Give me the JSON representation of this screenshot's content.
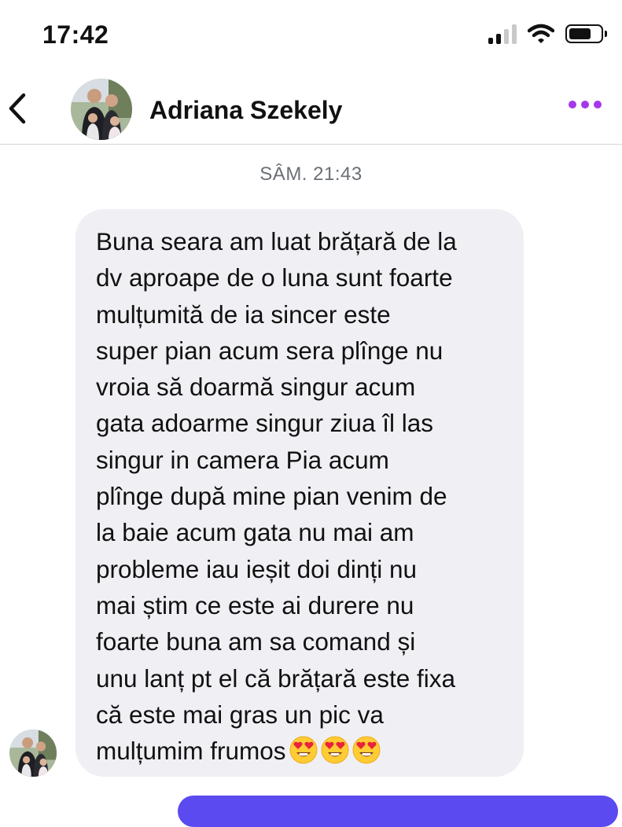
{
  "status_bar": {
    "time": "17:42",
    "icons": [
      "cellular-signal-icon",
      "wifi-icon",
      "battery-icon"
    ]
  },
  "header": {
    "contact_name": "Adriana Szekely",
    "icons": [
      "back-chevron-icon",
      "contact-avatar",
      "more-options-icon"
    ],
    "accent_color": "#a438ea"
  },
  "conversation": {
    "timestamp": "SÂM. 21:43",
    "messages": [
      {
        "sender": "Adriana Szekely",
        "direction": "incoming",
        "text": "Buna seara am luat brățară de la\ndv aproape de o luna sunt foarte\nmulțumită de ia sincer este\nsuper pian acum sera plînge nu\nvroia să doarmă singur acum\ngata adoarme singur ziua îl las\nsingur in camera Pia acum\nplînge după mine pian venim de\nla baie acum gata nu mai am\nprobleme iau ieșit doi dinți nu\nmai știm ce este ai durere nu\nfoarte buna am sa comand și\nunu lanț pt el că brățară este fixa\ncă este mai gras un pic va\nmulțumim frumos",
        "emojis": [
          "heart-eyes-emoji",
          "heart-eyes-emoji",
          "heart-eyes-emoji"
        ]
      }
    ]
  },
  "colors": {
    "incoming_bubble": "#f0f0f4",
    "outgoing_bubble": "#5b4af0",
    "timestamp_text": "#6b6f76"
  }
}
